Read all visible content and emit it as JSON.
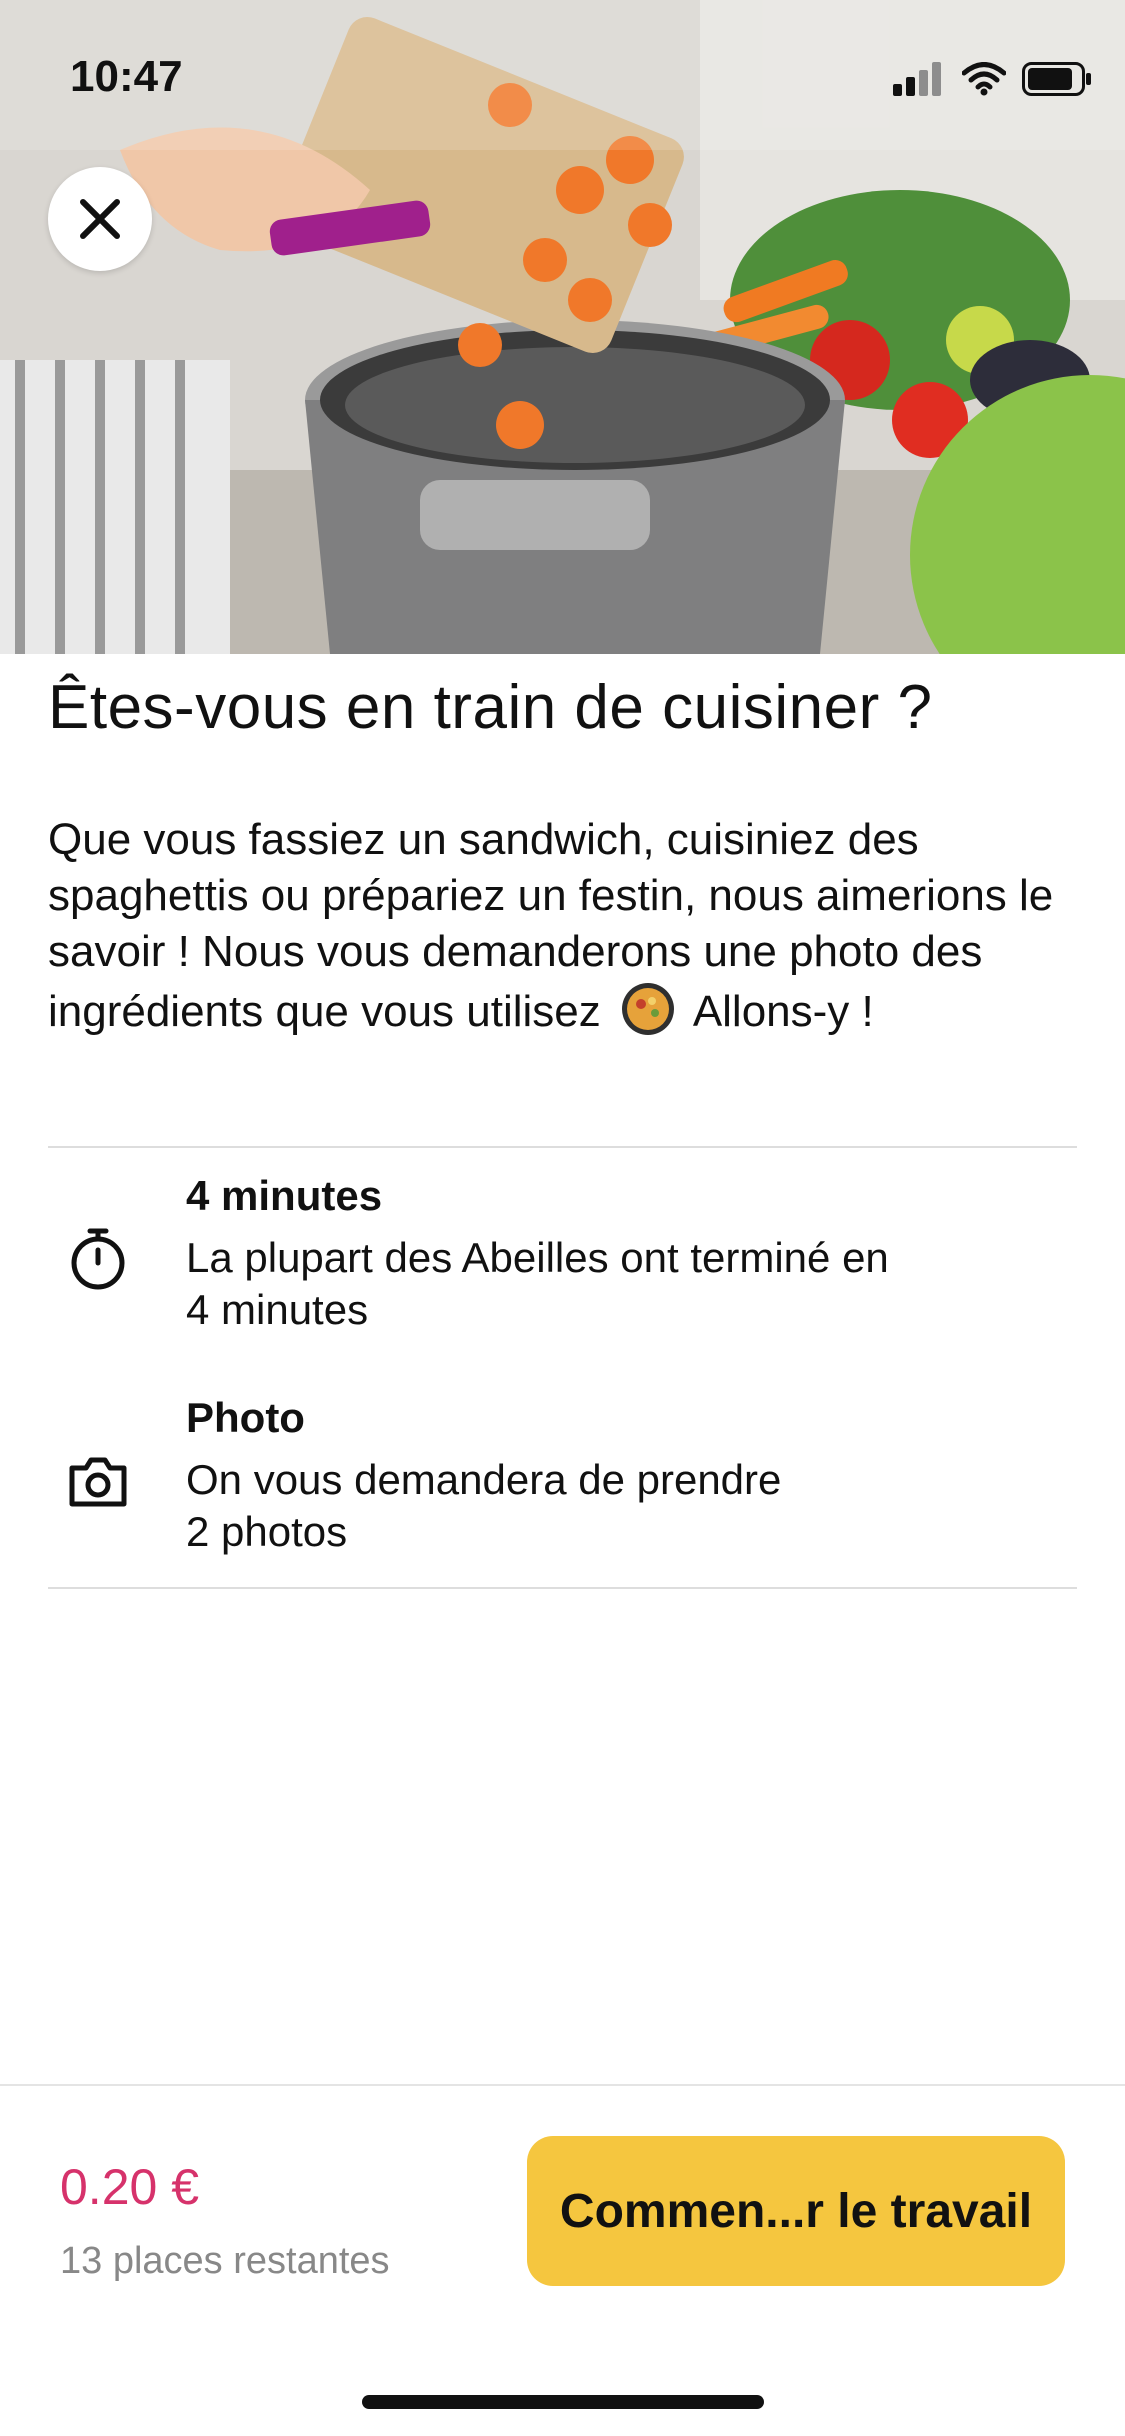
{
  "status_bar": {
    "time": "10:47"
  },
  "hero": {
    "image_description_icon": "cooking-photo",
    "accent_color": "#8bc34a"
  },
  "close_button": {
    "icon": "close-icon"
  },
  "content": {
    "title": "Êtes-vous en train de cuisiner ?",
    "description_part1": "Que vous fassiez un sandwich, cuisiniez des spaghettis ou prépariez un festin, nous aimerions le savoir ! Nous vous demanderons une photo des ingrédients que vous utilisez",
    "description_part2": "Allons-y !",
    "details": [
      {
        "icon": "stopwatch-icon",
        "heading": "4 minutes",
        "text_line1": "La plupart des Abeilles ont terminé en",
        "text_line2": "4 minutes"
      },
      {
        "icon": "camera-icon",
        "heading": "Photo",
        "text_line1": "On vous demandera de prendre",
        "text_line2": "2 photos"
      }
    ]
  },
  "footer": {
    "price": "0.20 €",
    "places": "13 places restantes",
    "start_label": "Commen...r le travail",
    "price_color": "#d6326b",
    "button_color": "#f5c63f"
  }
}
